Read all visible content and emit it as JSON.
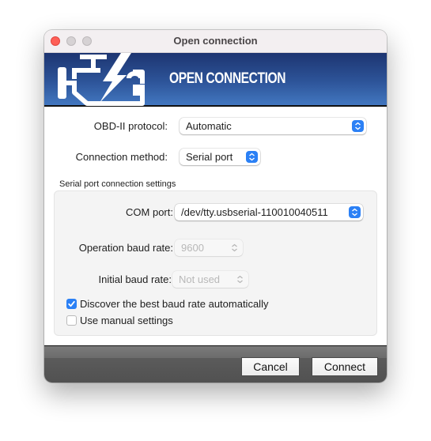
{
  "window": {
    "title": "Open connection"
  },
  "banner": {
    "title": "OPEN CONNECTION",
    "icon": "engine-check-lightning-icon",
    "gradient_top": "#1d3571",
    "gradient_bottom": "#4277c0"
  },
  "form": {
    "protocol": {
      "label": "OBD-II protocol:",
      "value": "Automatic"
    },
    "connection_method": {
      "label": "Connection method:",
      "value": "Serial port"
    },
    "section_title": "Serial port connection settings",
    "com_port": {
      "label": "COM port:",
      "value": "/dev/tty.usbserial-110010040511"
    },
    "operation_baud": {
      "label": "Operation baud rate:",
      "value": "9600",
      "enabled": false
    },
    "initial_baud": {
      "label": "Initial baud rate:",
      "value": "Not used",
      "enabled": false
    },
    "auto_baud": {
      "label": "Discover the best baud rate automatically",
      "checked": true
    },
    "manual_settings": {
      "label": "Use manual settings",
      "checked": false
    }
  },
  "footer": {
    "cancel_label": "Cancel",
    "connect_label": "Connect"
  },
  "colors": {
    "accent": "#2b80f5",
    "close_button": "#fe5f57"
  }
}
